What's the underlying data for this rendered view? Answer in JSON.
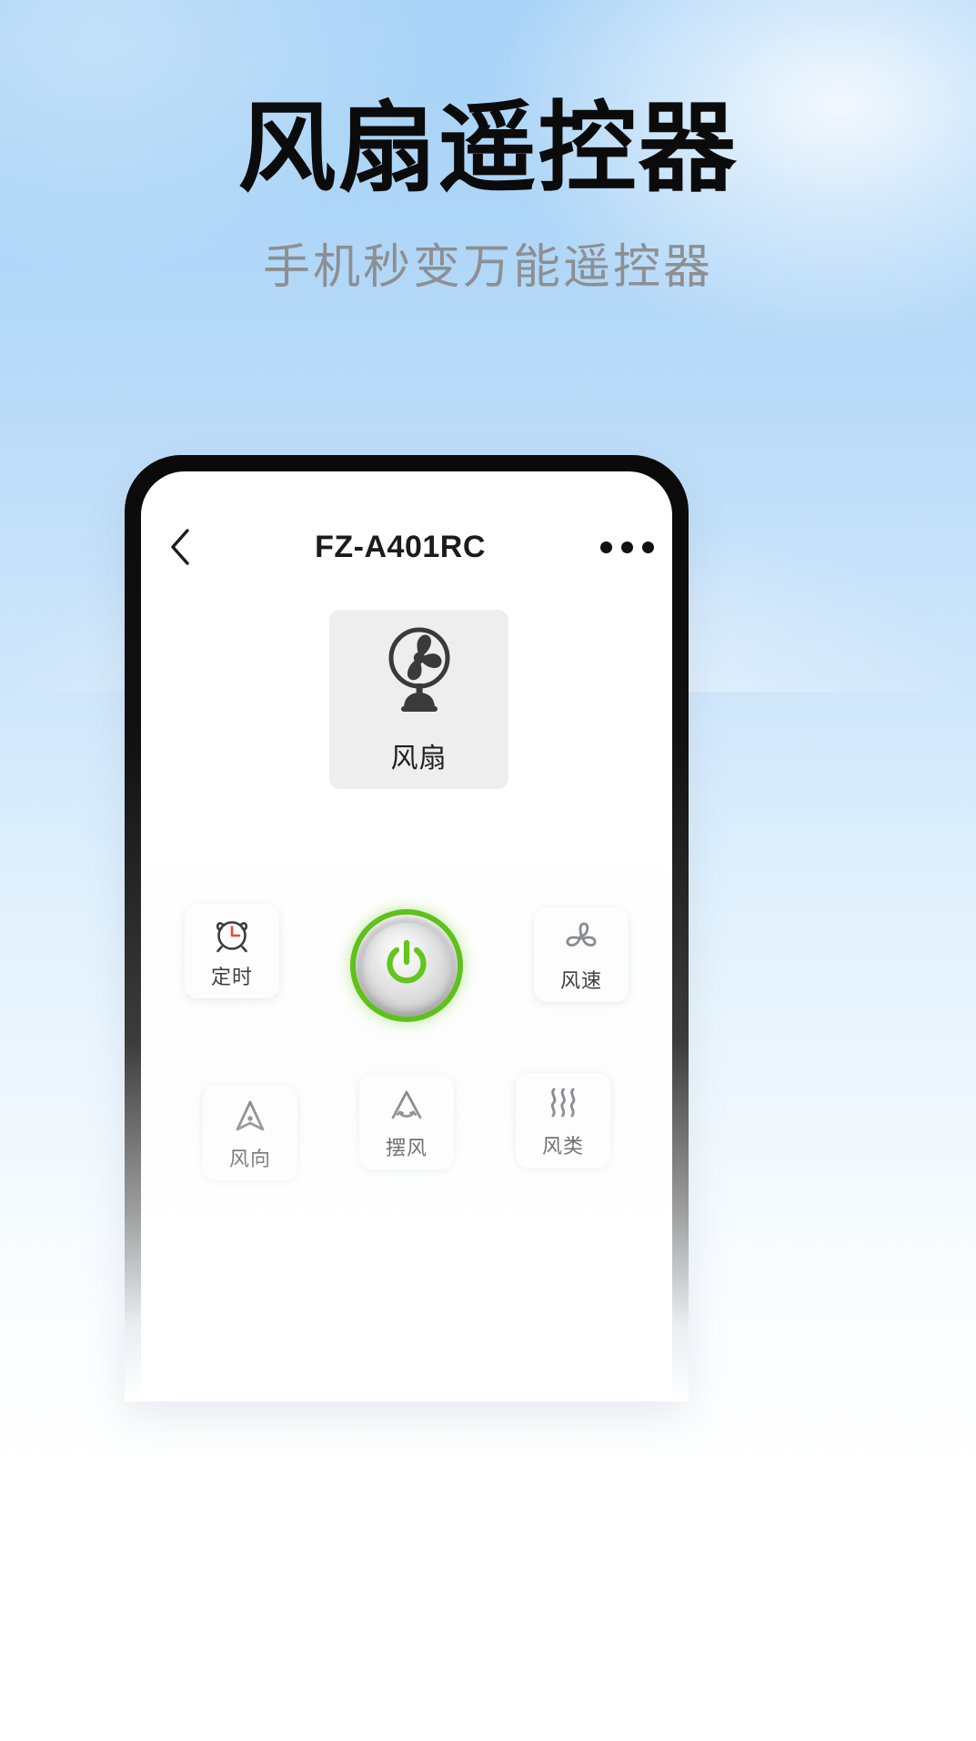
{
  "page": {
    "title": "风扇遥控器",
    "subtitle": "手机秒变万能遥控器",
    "background_top_color": "#A9D3F7",
    "background_bottom_color": "#FFFFFF"
  },
  "phone": {
    "navbar": {
      "back_icon": "chevron-left-icon",
      "title": "FZ-A401RC",
      "more_icon": "more-horizontal-icon"
    },
    "device_card": {
      "icon": "fan-icon",
      "label": "风扇",
      "background_color": "#EEEEEE"
    },
    "power_button": {
      "icon": "power-icon",
      "accent_color": "#5FC11A"
    },
    "controls": [
      {
        "id": "timer",
        "label": "定时",
        "icon": "alarm-clock-icon",
        "accent_color": "#E8483F"
      },
      {
        "id": "speed",
        "label": "风速",
        "icon": "fan-blades-icon",
        "accent_color": "#8A8A92"
      },
      {
        "id": "direction",
        "label": "风向",
        "icon": "navigation-arrow-icon",
        "accent_color": "#8A8A92"
      },
      {
        "id": "swing",
        "label": "摆风",
        "icon": "swing-chevron-icon",
        "accent_color": "#8A8A92"
      },
      {
        "id": "mode",
        "label": "风类",
        "icon": "wind-waves-icon",
        "accent_color": "#8A8A92"
      }
    ]
  }
}
